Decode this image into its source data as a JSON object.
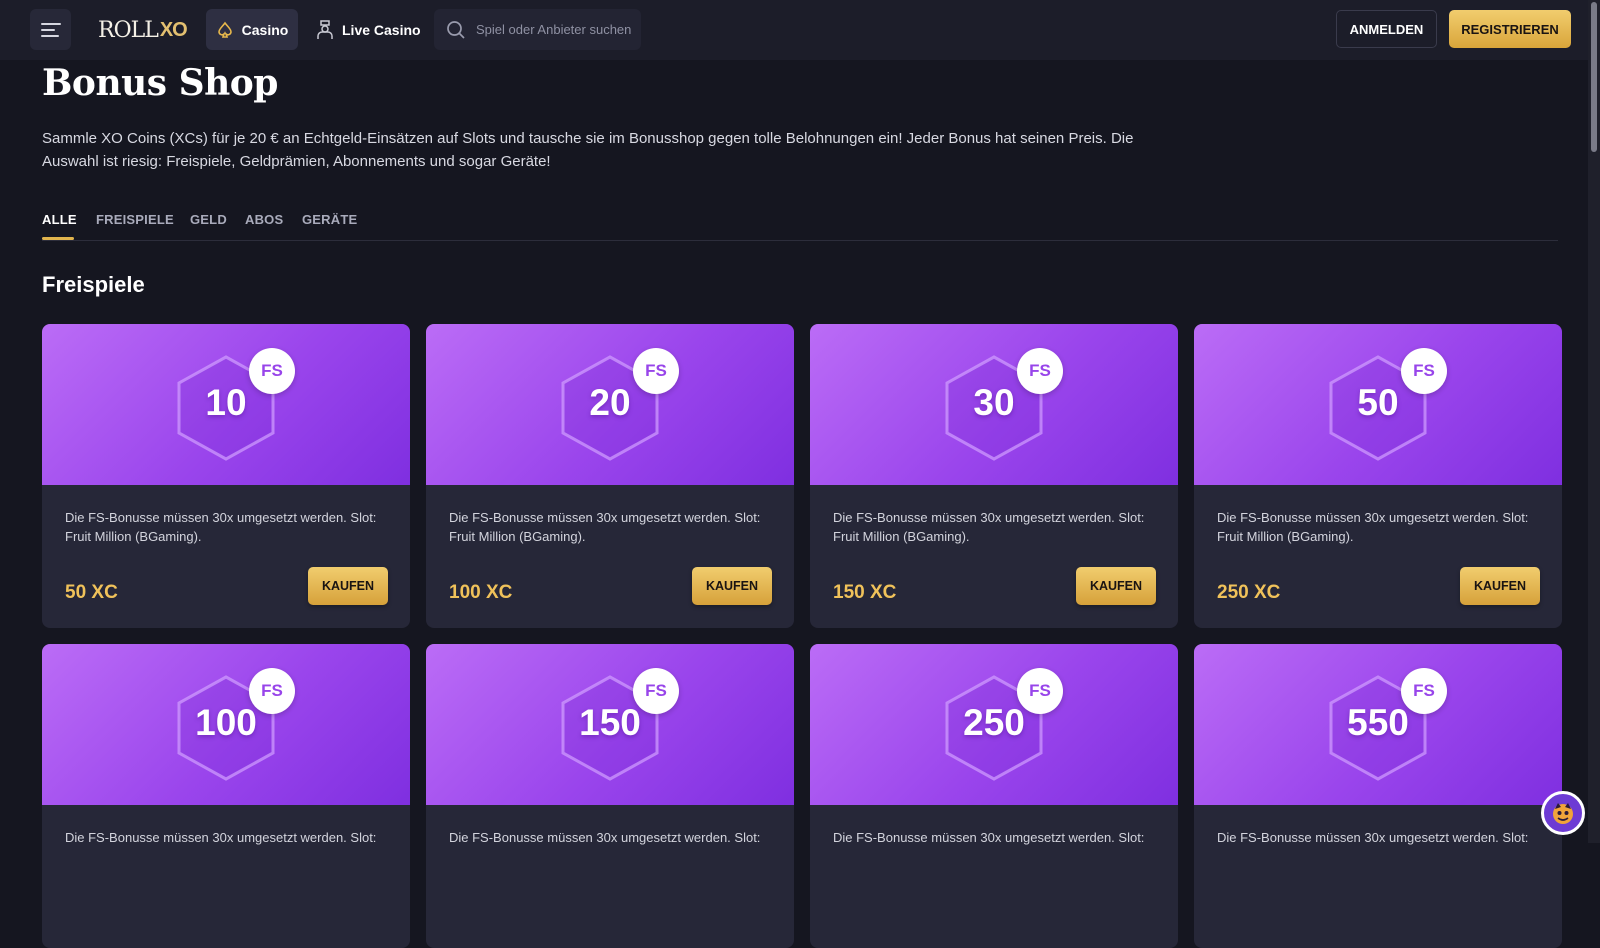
{
  "header": {
    "logo_text": "ROLL",
    "logo_xo": "XO",
    "nav": [
      {
        "label": "Casino",
        "icon": "spade-icon",
        "active": true
      },
      {
        "label": "Live Casino",
        "icon": "dealer-icon",
        "active": false
      }
    ],
    "search_placeholder": "Spiel oder Anbieter suchen",
    "login_label": "ANMELDEN",
    "register_label": "REGISTRIEREN"
  },
  "page": {
    "title": "Bonus Shop",
    "intro": "Sammle XO Coins (XCs) für je 20 € an Echtgeld-Einsätzen auf Slots und tausche sie im Bonusshop gegen tolle Belohnungen ein! Jeder Bonus hat seinen Preis. Die Auswahl ist riesig: Freispiele, Geldprämien, Abonnements und sogar Geräte!",
    "tabs": [
      {
        "label": "ALLE",
        "active": true
      },
      {
        "label": "FREISPIELE",
        "active": false
      },
      {
        "label": "GELD",
        "active": false
      },
      {
        "label": "ABOS",
        "active": false
      },
      {
        "label": "GERÄTE",
        "active": false
      }
    ],
    "section_title": "Freispiele"
  },
  "cards": [
    {
      "amount": "10",
      "badge": "FS",
      "desc": "Die FS-Bonusse müssen 30x umgesetzt werden. Slot: Fruit Million (BGaming).",
      "price": "50 XC",
      "buy": "KAUFEN"
    },
    {
      "amount": "20",
      "badge": "FS",
      "desc": "Die FS-Bonusse müssen 30x umgesetzt werden. Slot: Fruit Million (BGaming).",
      "price": "100 XC",
      "buy": "KAUFEN"
    },
    {
      "amount": "30",
      "badge": "FS",
      "desc": "Die FS-Bonusse müssen 30x umgesetzt werden. Slot: Fruit Million (BGaming).",
      "price": "150 XC",
      "buy": "KAUFEN"
    },
    {
      "amount": "50",
      "badge": "FS",
      "desc": "Die FS-Bonusse müssen 30x umgesetzt werden. Slot: Fruit Million (BGaming).",
      "price": "250 XC",
      "buy": "KAUFEN"
    },
    {
      "amount": "100",
      "badge": "FS",
      "desc": "Die FS-Bonusse müssen 30x umgesetzt werden. Slot:",
      "price": "",
      "buy": ""
    },
    {
      "amount": "150",
      "badge": "FS",
      "desc": "Die FS-Bonusse müssen 30x umgesetzt werden. Slot:",
      "price": "",
      "buy": ""
    },
    {
      "amount": "250",
      "badge": "FS",
      "desc": "Die FS-Bonusse müssen 30x umgesetzt werden. Slot:",
      "price": "",
      "buy": ""
    },
    {
      "amount": "550",
      "badge": "FS",
      "desc": "Die FS-Bonusse müssen 30x umgesetzt werden. Slot:",
      "price": "",
      "buy": ""
    }
  ],
  "colors": {
    "accent_gold": "#e1b44d",
    "card_purple": "#9a45ec",
    "background": "#151620"
  },
  "chat_icon": "support-avatar-icon"
}
